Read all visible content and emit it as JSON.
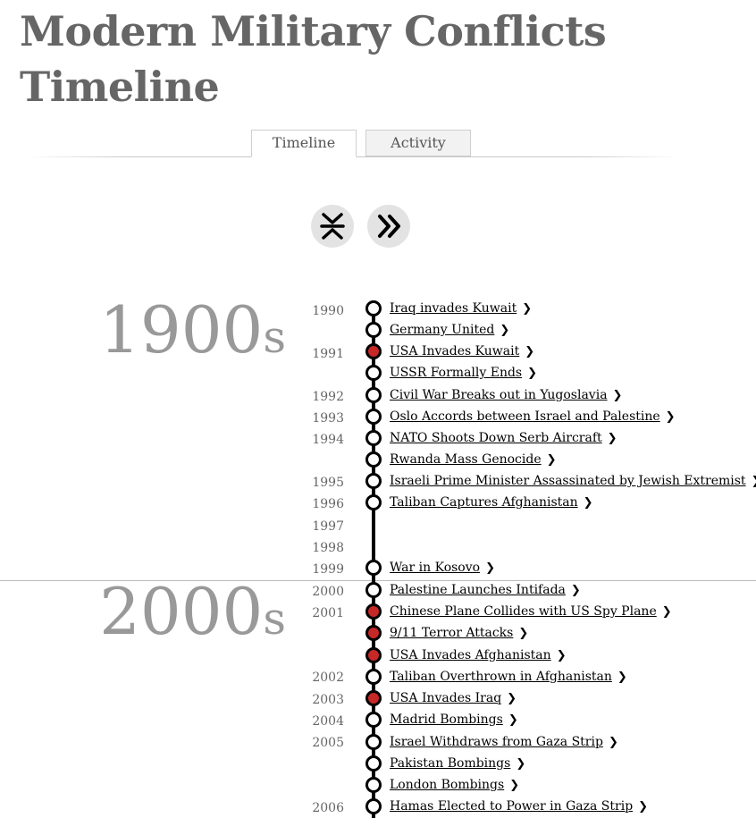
{
  "title_line1": "Modern Military Conflicts",
  "title_line2": "Timeline",
  "tabs": [
    {
      "label": "Timeline",
      "active": true
    },
    {
      "label": "Activity",
      "active": false
    }
  ],
  "controls": {
    "collapse_icon": "collapse-arrows-icon",
    "forward_icon": "double-chevron-right-icon"
  },
  "colors": {
    "highlight_dot": "#c62828",
    "title": "#666666",
    "decade": "#999999"
  },
  "decades": [
    {
      "number": "1900",
      "suffix": "s"
    },
    {
      "number": "2000",
      "suffix": "s"
    }
  ],
  "years": [
    "1990",
    "1991",
    "1992",
    "1993",
    "1994",
    "1995",
    "1996",
    "1997",
    "1998",
    "1999",
    "2000",
    "2001",
    "2002",
    "2003",
    "2004",
    "2005",
    "2006"
  ],
  "events": [
    {
      "label": "Iraq invades Kuwait",
      "highlight": false
    },
    {
      "label": "Germany United",
      "highlight": false
    },
    {
      "label": "USA Invades Kuwait",
      "highlight": true
    },
    {
      "label": "USSR Formally Ends",
      "highlight": false
    },
    {
      "label": "Civil War Breaks out in Yugoslavia",
      "highlight": false
    },
    {
      "label": "Oslo Accords between Israel and Palestine",
      "highlight": false
    },
    {
      "label": "NATO Shoots Down Serb Aircraft",
      "highlight": false
    },
    {
      "label": "Rwanda Mass Genocide",
      "highlight": false
    },
    {
      "label": "Israeli Prime Minister Assassinated by Jewish Extremist",
      "highlight": false
    },
    {
      "label": "Taliban Captures Afghanistan",
      "highlight": false
    },
    {
      "label": "War in Kosovo",
      "highlight": false
    },
    {
      "label": "Palestine Launches Intifada",
      "highlight": false
    },
    {
      "label": "Chinese Plane Collides with US Spy Plane",
      "highlight": true
    },
    {
      "label": "9/11 Terror Attacks",
      "highlight": true
    },
    {
      "label": "USA Invades Afghanistan",
      "highlight": true
    },
    {
      "label": "Taliban Overthrown in Afghanistan",
      "highlight": false
    },
    {
      "label": "USA Invades Iraq",
      "highlight": true
    },
    {
      "label": "Madrid Bombings",
      "highlight": false
    },
    {
      "label": "Israel Withdraws from Gaza Strip",
      "highlight": false
    },
    {
      "label": "Pakistan Bombings",
      "highlight": false
    },
    {
      "label": "London Bombings",
      "highlight": false
    },
    {
      "label": "Hamas Elected to Power in Gaza Strip",
      "highlight": false
    }
  ]
}
